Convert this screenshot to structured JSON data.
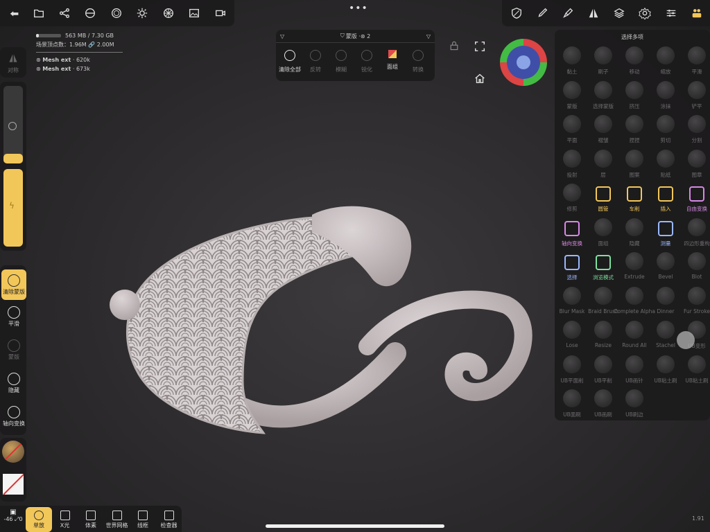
{
  "stats": {
    "memory": "563 MB / 7.30 GB",
    "vertices_label": "场景顶点数：1.96M",
    "vertices_extra": "2.00M",
    "meshes": [
      {
        "name": "Mesh ext",
        "count": "620k"
      },
      {
        "name": "Mesh ext",
        "count": "673k"
      }
    ]
  },
  "top_left_tools": [
    "back-icon",
    "folder-icon",
    "scene-graph-icon",
    "material-icon",
    "shading-icon",
    "light-icon",
    "postprocess-icon",
    "image-icon",
    "camera-icon"
  ],
  "top_right_tools": [
    "mask-tool-icon",
    "brush-icon",
    "paint-tool-icon",
    "symmetry-icon",
    "layers-icon",
    "settings-icon",
    "sliders-icon",
    "team-icon"
  ],
  "mask_panel": {
    "title": "蒙版 · ",
    "count": "2",
    "items": [
      {
        "label": "清除全部",
        "icon": "clear-all-icon",
        "active": true
      },
      {
        "label": "反转",
        "icon": "invert-icon",
        "active": false
      },
      {
        "label": "模糊",
        "icon": "blur-icon",
        "active": false
      },
      {
        "label": "锐化",
        "icon": "sharpen-icon",
        "active": false
      },
      {
        "label": "面组",
        "icon": "facegroup-icon",
        "active": true
      },
      {
        "label": "转换",
        "icon": "convert-icon",
        "active": false
      }
    ]
  },
  "right_panel": {
    "title": "选择多项",
    "tools": [
      {
        "label": "黏土",
        "state": "dim"
      },
      {
        "label": "刷子",
        "state": "dim"
      },
      {
        "label": "移动",
        "state": "dim"
      },
      {
        "label": "缩放",
        "state": "dim"
      },
      {
        "label": "平滑",
        "state": "dim"
      },
      {
        "label": "蒙版",
        "state": "dim"
      },
      {
        "label": "选择蒙版",
        "state": "dim"
      },
      {
        "label": "挤压",
        "state": "dim"
      },
      {
        "label": "涂抹",
        "state": "dim"
      },
      {
        "label": "铲平",
        "state": "dim"
      },
      {
        "label": "平面",
        "state": "dim"
      },
      {
        "label": "褶皱",
        "state": "dim"
      },
      {
        "label": "捏捏",
        "state": "dim"
      },
      {
        "label": "剪切",
        "state": "dim"
      },
      {
        "label": "分割",
        "state": "dim"
      },
      {
        "label": "投射",
        "state": "dim"
      },
      {
        "label": "层",
        "state": "dim"
      },
      {
        "label": "图案",
        "state": "dim"
      },
      {
        "label": "贴纸",
        "state": "dim"
      },
      {
        "label": "图章",
        "state": "dim"
      },
      {
        "label": "修剪",
        "state": "dim"
      },
      {
        "label": "圆管",
        "state": "yellow"
      },
      {
        "label": "车削",
        "state": "yellow"
      },
      {
        "label": "插入",
        "state": "yellow"
      },
      {
        "label": "自由变换",
        "state": "purple"
      },
      {
        "label": "轴向变换",
        "state": "purple"
      },
      {
        "label": "面组",
        "state": "dim"
      },
      {
        "label": "隐藏",
        "state": "dim"
      },
      {
        "label": "测量",
        "state": "blue"
      },
      {
        "label": "四边形重构",
        "state": "dim"
      },
      {
        "label": "选择",
        "state": "blue"
      },
      {
        "label": "浏览模式",
        "state": "green"
      },
      {
        "label": "Extrude",
        "state": "dim"
      },
      {
        "label": "Bevel",
        "state": "dim"
      },
      {
        "label": "Blot",
        "state": "dim"
      },
      {
        "label": "Blur Mask",
        "state": "dim"
      },
      {
        "label": "Braid Brush",
        "state": "dim"
      },
      {
        "label": "Complete Alpha",
        "state": "dim"
      },
      {
        "label": "Dinner",
        "state": "dim"
      },
      {
        "label": "Fur Stroke",
        "state": "dim"
      },
      {
        "label": "Lose",
        "state": "dim"
      },
      {
        "label": "Resize",
        "state": "dim"
      },
      {
        "label": "Round All",
        "state": "dim"
      },
      {
        "label": "Stachel",
        "state": "dim"
      },
      {
        "label": "UB变形",
        "state": "dim"
      },
      {
        "label": "UB平面削",
        "state": "dim"
      },
      {
        "label": "UB平削",
        "state": "dim"
      },
      {
        "label": "UB画针",
        "state": "dim"
      },
      {
        "label": "UB粘土刷",
        "state": "dim"
      },
      {
        "label": "UB粘土刷",
        "state": "dim"
      },
      {
        "label": "UB面刷",
        "state": "dim"
      },
      {
        "label": "UB画刷",
        "state": "dim"
      },
      {
        "label": "UB刷边",
        "state": "dim"
      }
    ]
  },
  "left_panel": {
    "top_label": "对称",
    "tools": [
      {
        "label": "清除蒙版",
        "state": "active"
      },
      {
        "label": "平滑",
        "state": "normal"
      },
      {
        "label": "蒙版",
        "state": "dim"
      },
      {
        "label": "隐藏",
        "state": "normal"
      },
      {
        "label": "轴向变换",
        "state": "normal"
      }
    ]
  },
  "bottom_bar": {
    "coords": "-46 ⤢0",
    "items": [
      {
        "label": "单放",
        "icon": "zoom-icon",
        "active": true
      },
      {
        "label": "X光",
        "icon": "xray-icon",
        "active": false
      },
      {
        "label": "体素",
        "icon": "voxel-icon",
        "active": false
      },
      {
        "label": "世界网格",
        "icon": "grid-icon",
        "active": false
      },
      {
        "label": "线框",
        "icon": "wireframe-icon",
        "active": false
      },
      {
        "label": "检查器",
        "icon": "inspector-icon",
        "active": false
      }
    ]
  },
  "version": "1.91",
  "colors": {
    "accent": "#f2c75a",
    "panel": "#1c1b1c",
    "model": "#c9c2c3"
  }
}
